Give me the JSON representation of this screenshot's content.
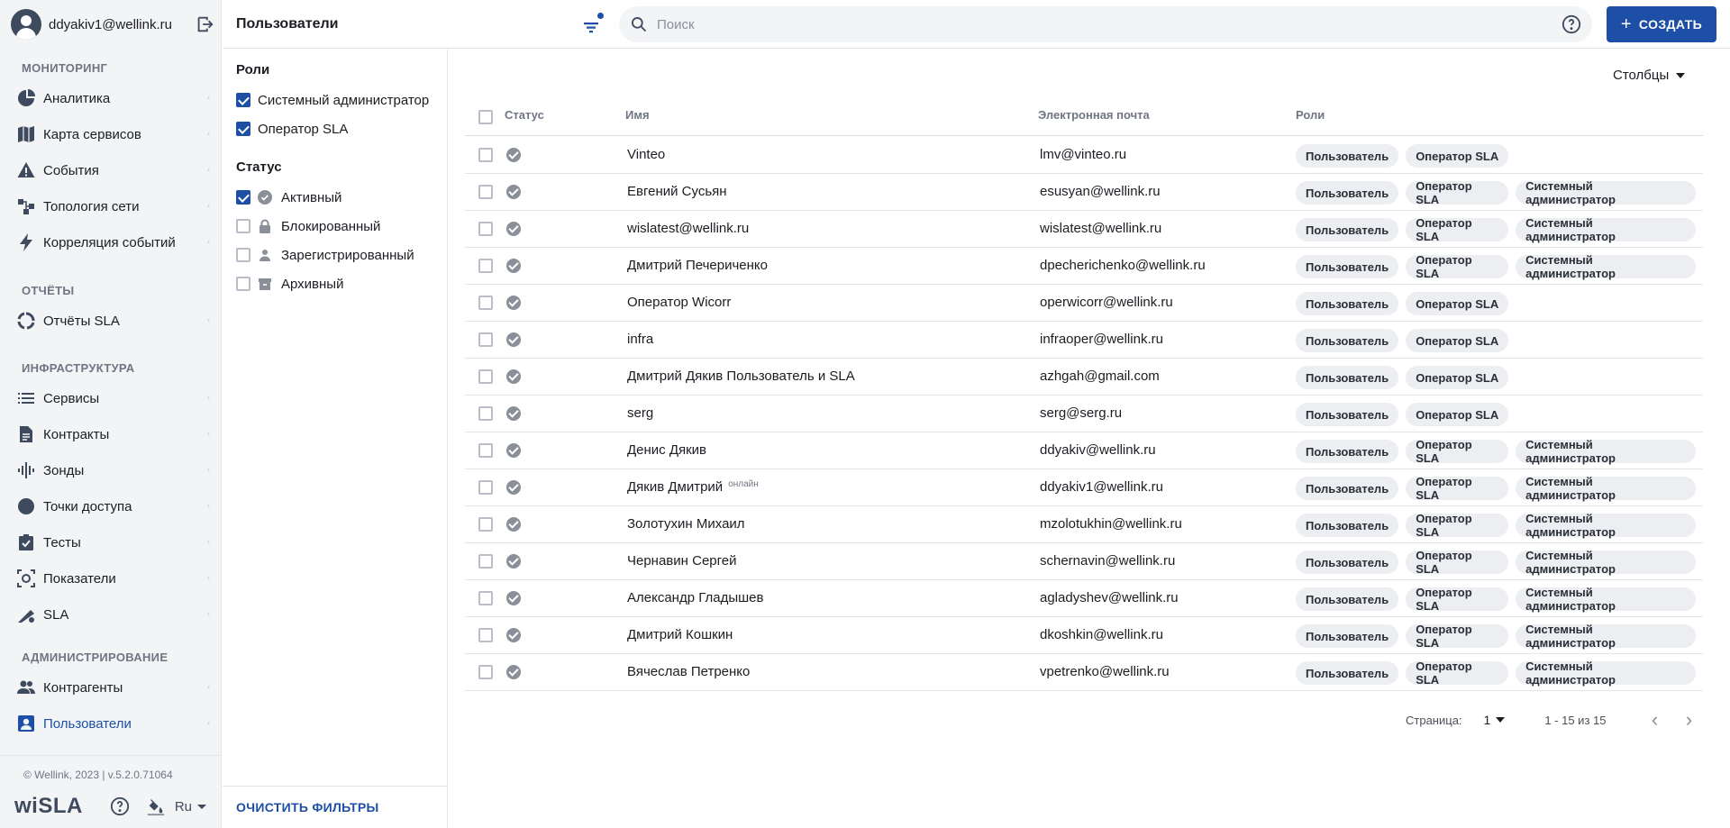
{
  "user": {
    "email": "ddyakiv1@wellink.ru"
  },
  "nav": {
    "sections": [
      {
        "title": "МОНИТОРИНГ",
        "items": [
          {
            "label": "Аналитика",
            "icon": "analytics-icon"
          },
          {
            "label": "Карта сервисов",
            "icon": "map-icon"
          },
          {
            "label": "События",
            "icon": "warning-icon"
          },
          {
            "label": "Топология сети",
            "icon": "topology-icon"
          },
          {
            "label": "Корреляция событий",
            "icon": "lightning-icon"
          }
        ]
      },
      {
        "title": "ОТЧЁТЫ",
        "items": [
          {
            "label": "Отчёты SLA",
            "icon": "report-icon"
          }
        ]
      },
      {
        "title": "ИНФРАСТРУКТУРА",
        "items": [
          {
            "label": "Сервисы",
            "icon": "list-icon"
          },
          {
            "label": "Контракты",
            "icon": "document-icon"
          },
          {
            "label": "Зонды",
            "icon": "probe-icon"
          },
          {
            "label": "Точки доступа",
            "icon": "circle-icon"
          },
          {
            "label": "Тесты",
            "icon": "clipboard-check-icon"
          },
          {
            "label": "Показатели",
            "icon": "metrics-icon"
          },
          {
            "label": "SLA",
            "icon": "sla-icon"
          }
        ]
      },
      {
        "title": "АДМИНИСТРИРОВАНИЕ",
        "items": [
          {
            "label": "Контрагенты",
            "icon": "people-icon"
          },
          {
            "label": "Пользователи",
            "icon": "user-card-icon",
            "active": true
          }
        ]
      }
    ],
    "copyright": "© Wellink, 2023 | v.5.2.0.71064",
    "logo": "wiSLA",
    "language": "Ru"
  },
  "header": {
    "title": "Пользователи",
    "search_placeholder": "Поиск",
    "create_label": "СОЗДАТЬ"
  },
  "filters": {
    "roles_title": "Роли",
    "roles": [
      {
        "label": "Системный администратор",
        "checked": true
      },
      {
        "label": "Оператор SLA",
        "checked": true
      }
    ],
    "status_title": "Статус",
    "statuses": [
      {
        "label": "Активный",
        "checked": true,
        "icon": "check-circle-icon"
      },
      {
        "label": "Блокированный",
        "checked": false,
        "icon": "lock-icon"
      },
      {
        "label": "Зарегистрированный",
        "checked": false,
        "icon": "person-icon"
      },
      {
        "label": "Архивный",
        "checked": false,
        "icon": "archive-icon"
      }
    ],
    "clear_label": "ОЧИСТИТЬ ФИЛЬТРЫ"
  },
  "table": {
    "columns_button": "Столбцы",
    "headers": {
      "status": "Статус",
      "name": "Имя",
      "email": "Электронная почта",
      "roles": "Роли"
    },
    "rows": [
      {
        "name": "Vinteo",
        "email": "lmv@vinteo.ru",
        "roles": [
          "Пользователь",
          "Оператор SLA"
        ]
      },
      {
        "name": "Евгений Сусьян",
        "email": "esusyan@wellink.ru",
        "roles": [
          "Пользователь",
          "Оператор SLA",
          "Системный администратор"
        ]
      },
      {
        "name": "wislatest@wellink.ru",
        "email": "wislatest@wellink.ru",
        "roles": [
          "Пользователь",
          "Оператор SLA",
          "Системный администратор"
        ]
      },
      {
        "name": "Дмитрий Печериченко",
        "email": "dpecherichenko@wellink.ru",
        "roles": [
          "Пользователь",
          "Оператор SLA",
          "Системный администратор"
        ]
      },
      {
        "name": "Оператор Wicorr",
        "email": "operwicorr@wellink.ru",
        "roles": [
          "Пользователь",
          "Оператор SLA"
        ]
      },
      {
        "name": "infra",
        "email": "infraoper@wellink.ru",
        "roles": [
          "Пользователь",
          "Оператор SLA"
        ]
      },
      {
        "name": "Дмитрий Дякив Пользователь и SLA",
        "email": "azhgah@gmail.com",
        "roles": [
          "Пользователь",
          "Оператор SLA"
        ]
      },
      {
        "name": "serg",
        "email": "serg@serg.ru",
        "roles": [
          "Пользователь",
          "Оператор SLA"
        ]
      },
      {
        "name": "Денис Дякив",
        "email": "ddyakiv@wellink.ru",
        "roles": [
          "Пользователь",
          "Оператор SLA",
          "Системный администратор"
        ]
      },
      {
        "name": "Дякив Дмитрий",
        "online": "онлайн",
        "email": "ddyakiv1@wellink.ru",
        "roles": [
          "Пользователь",
          "Оператор SLA",
          "Системный администратор"
        ]
      },
      {
        "name": "Золотухин Михаил",
        "email": "mzolotukhin@wellink.ru",
        "roles": [
          "Пользователь",
          "Оператор SLA",
          "Системный администратор"
        ]
      },
      {
        "name": "Чернавин Сергей",
        "email": "schernavin@wellink.ru",
        "roles": [
          "Пользователь",
          "Оператор SLA",
          "Системный администратор"
        ]
      },
      {
        "name": "Александр Гладышев",
        "email": "agladyshev@wellink.ru",
        "roles": [
          "Пользователь",
          "Оператор SLA",
          "Системный администратор"
        ]
      },
      {
        "name": "Дмитрий Кошкин",
        "email": "dkoshkin@wellink.ru",
        "roles": [
          "Пользователь",
          "Оператор SLA",
          "Системный администратор"
        ]
      },
      {
        "name": "Вячеслав Петренко",
        "email": "vpetrenko@wellink.ru",
        "roles": [
          "Пользователь",
          "Оператор SLA",
          "Системный администратор"
        ]
      }
    ]
  },
  "pagination": {
    "page_label": "Страница:",
    "page": "1",
    "range": "1 - 15 из 15"
  },
  "colors": {
    "accent": "#1d4fa6",
    "nav_bg": "#f3f4f6",
    "chip_bg": "#eceef1"
  }
}
